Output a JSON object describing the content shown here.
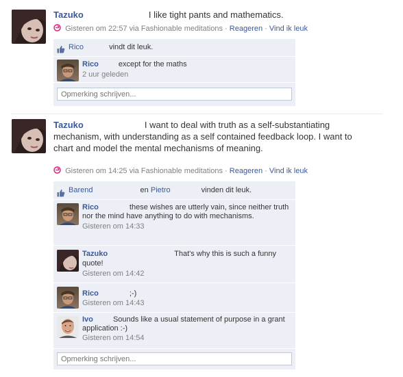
{
  "posts": [
    {
      "author": "Tazuko",
      "text": "I like tight pants and mathematics.",
      "timestamp": "Gisteren om 22:57",
      "via": "via Fashionable meditations",
      "sep": "·",
      "reply": "Reageren",
      "like": "Vind ik leuk",
      "likes": {
        "name1": "Rico",
        "suffix": "vindt dit leuk."
      },
      "comments": [
        {
          "author": "Rico",
          "text": "except for the maths",
          "time": "2 uur geleden"
        }
      ],
      "write_placeholder": "Opmerking schrijven..."
    },
    {
      "author": "Tazuko",
      "text": "I want to deal with truth as a self-substantiating mechanism, with understanding as a self contained feedback loop. I want to chart and model the mental mechanisms of meaning.",
      "timestamp": "Gisteren om 14:25",
      "via": "via Fashionable meditations",
      "sep": "·",
      "reply": "Reageren",
      "like": "Vind ik leuk",
      "likes": {
        "name1": "Barend",
        "and": "en",
        "name2": "Pietro",
        "suffix": "vinden dit leuk."
      },
      "comments": [
        {
          "author": "Rico",
          "text": "these wishes are utterly vain, since neither truth nor the mind have anything to do with mechanisms.",
          "time": "Gisteren om 14:33"
        },
        {
          "author": "Tazuko",
          "text": "That's why this is such a funny quote!",
          "time": "Gisteren om 14:42"
        },
        {
          "author": "Rico",
          "text": ";-)",
          "time": "Gisteren om 14:43"
        },
        {
          "author": "Ivo",
          "text": "Sounds like a usual statement of purpose in a grant application :-)",
          "time": "Gisteren om 14:54"
        }
      ],
      "write_placeholder": "Opmerking schrijven..."
    }
  ],
  "colors": {
    "link": "#3b5998",
    "box": "#eceff5",
    "app_icon": "#d6257a"
  }
}
